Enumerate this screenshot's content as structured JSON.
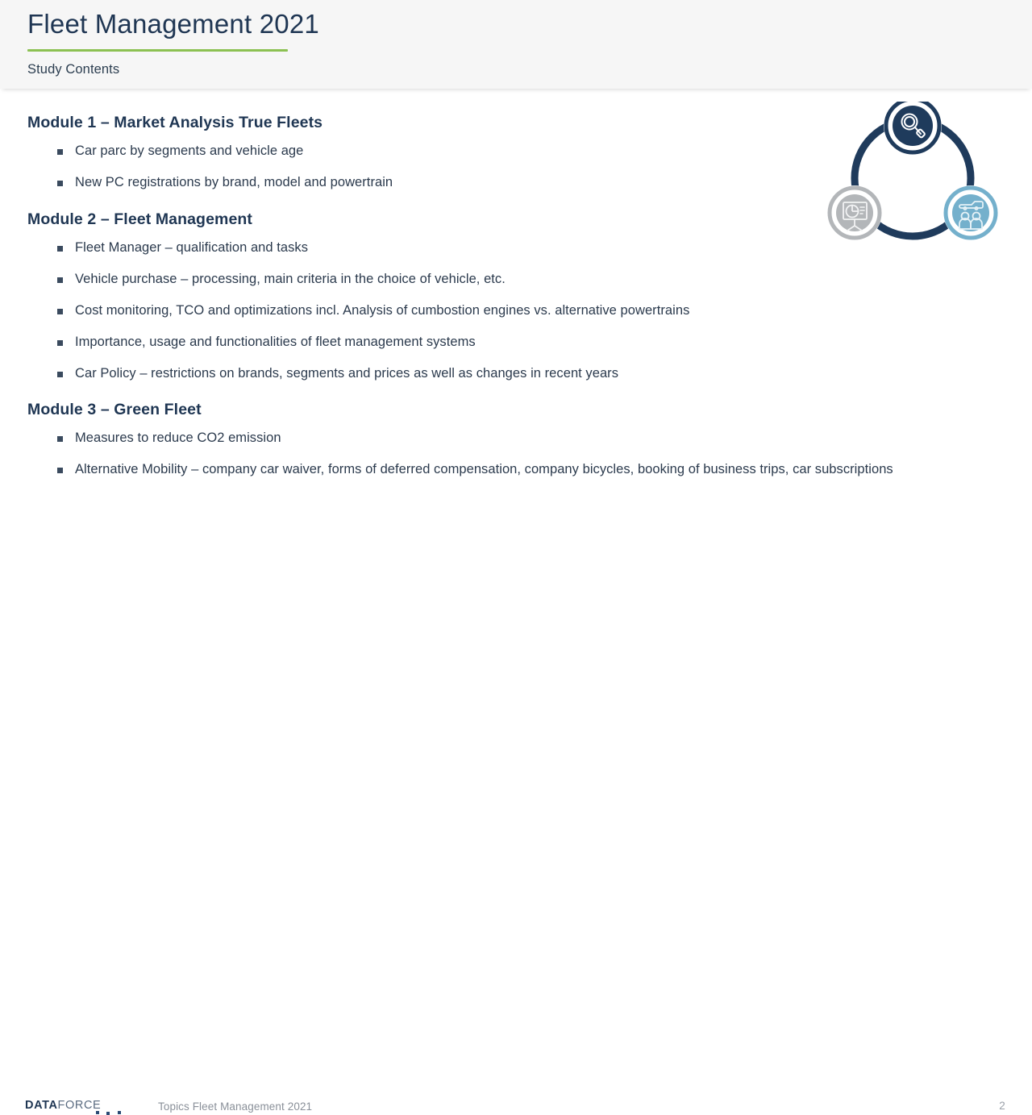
{
  "header": {
    "title": "Fleet Management 2021",
    "subtitle": "Study Contents",
    "accent_green": "#8cc152",
    "title_color": "#1f3653",
    "background": "#f6f6f6"
  },
  "modules": [
    {
      "title": "Module 1 – Market Analysis True Fleets",
      "bullets": [
        "Car parc by segments and vehicle age",
        "New PC registrations by brand, model and powertrain"
      ]
    },
    {
      "title": "Module 2 – Fleet Management",
      "bullets": [
        "Fleet Manager – qualification and tasks",
        "Vehicle purchase – processing, main criteria in the choice of vehicle, etc.",
        "Cost monitoring, TCO and optimizations incl. Analysis of cumbostion engines vs. alternative powertrains",
        "Importance, usage and functionalities of fleet management systems",
        "Car Policy – restrictions on brands, segments and prices as well as changes in recent years"
      ]
    },
    {
      "title": "Module 3 – Green Fleet",
      "bullets": [
        "Measures to reduce CO2 emission",
        "Alternative Mobility – company car waiver, forms of deferred compensation, company bicycles, booking of business trips, car subscriptions"
      ]
    }
  ],
  "graphic": {
    "name": "three-module-cycle-diagram",
    "ring_color": "#1f3b5c",
    "nodes": [
      {
        "id": "node-research",
        "icon": "magnifier-icon",
        "fill": "#1f3b5c",
        "ring": "#1f3b5c",
        "icon_color": "#ffffff"
      },
      {
        "id": "node-presentation",
        "icon": "presentation-chart-icon",
        "fill": "#b3b6b9",
        "ring": "#b3b6b9",
        "icon_color": "#f2f3f4"
      },
      {
        "id": "node-people-fleet",
        "icon": "people-vehicle-icon",
        "fill": "#74b0cc",
        "ring": "#74b0cc",
        "icon_color": "#e6f2f7"
      }
    ]
  },
  "footer": {
    "logo_primary": "DATA",
    "logo_secondary": "FORCE",
    "text": "Topics Fleet Management 2021",
    "page_number": "2"
  }
}
